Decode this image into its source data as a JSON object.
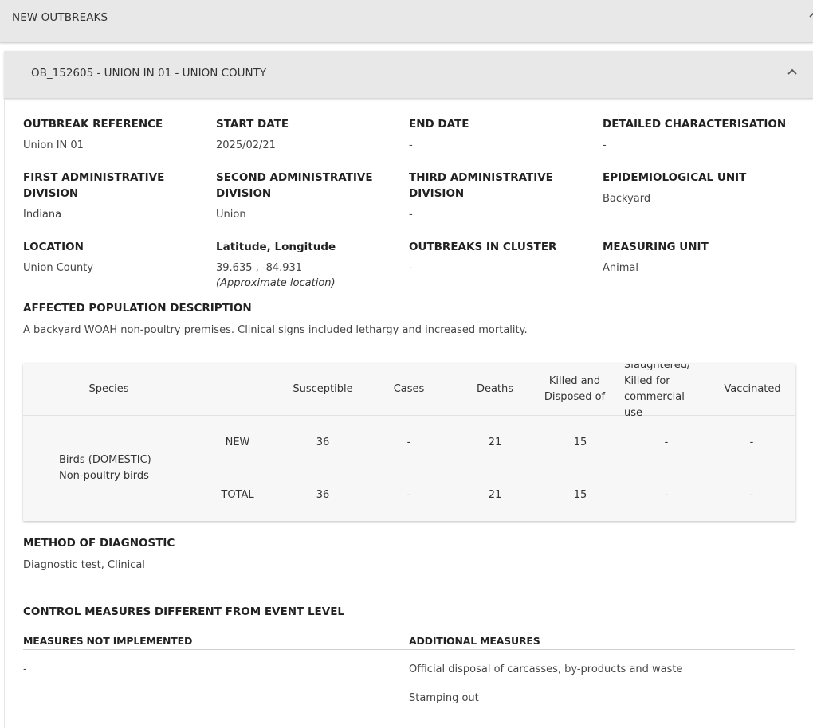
{
  "outer_header": {
    "title": "NEW OUTBREAKS"
  },
  "outbreak_header": {
    "title": "OB_152605 - UNION IN 01 - UNION COUNTY"
  },
  "fields": [
    {
      "label": "OUTBREAK REFERENCE",
      "value": "Union IN 01"
    },
    {
      "label": "START DATE",
      "value": "2025/02/21"
    },
    {
      "label": "END DATE",
      "value": "-"
    },
    {
      "label": "DETAILED CHARACTERISATION",
      "value": "-"
    },
    {
      "label": "FIRST ADMINISTRATIVE DIVISION",
      "value": "Indiana"
    },
    {
      "label": "SECOND ADMINISTRATIVE DIVISION",
      "value": "Union"
    },
    {
      "label": "THIRD ADMINISTRATIVE DIVISION",
      "value": "-"
    },
    {
      "label": "EPIDEMIOLOGICAL UNIT",
      "value": "Backyard"
    },
    {
      "label": "LOCATION",
      "value": "Union County"
    },
    {
      "label": "Latitude, Longitude",
      "value": "39.635 , -84.931",
      "note": "(Approximate location)"
    },
    {
      "label": "OUTBREAKS IN CLUSTER",
      "value": "-"
    },
    {
      "label": "MEASURING UNIT",
      "value": "Animal"
    }
  ],
  "affected_population": {
    "title": "AFFECTED POPULATION DESCRIPTION",
    "text": "A backyard WOAH non-poultry premises. Clinical signs included lethargy and increased mortality."
  },
  "species_table": {
    "headers": {
      "species": "Species",
      "susceptible": "Susceptible",
      "cases": "Cases",
      "deaths": "Deaths",
      "killed": "Killed and Disposed of",
      "slaughtered": "Slaughtered/ Killed for commercial use",
      "vaccinated": "Vaccinated"
    },
    "species_name": "Birds (DOMESTIC)",
    "species_sub": "Non-poultry birds",
    "rows": [
      {
        "label": "NEW",
        "susceptible": "36",
        "cases": "-",
        "deaths": "21",
        "killed": "15",
        "slaughtered": "-",
        "vaccinated": "-"
      },
      {
        "label": "TOTAL",
        "susceptible": "36",
        "cases": "-",
        "deaths": "21",
        "killed": "15",
        "slaughtered": "-",
        "vaccinated": "-"
      }
    ]
  },
  "diagnostic": {
    "title": "METHOD OF DIAGNOSTIC",
    "text": "Diagnostic test, Clinical"
  },
  "control_measures": {
    "title": "CONTROL MEASURES DIFFERENT FROM EVENT LEVEL",
    "not_implemented_head": "MEASURES NOT IMPLEMENTED",
    "additional_head": "ADDITIONAL MEASURES",
    "not_implemented": [
      "-"
    ],
    "additional": [
      "Official disposal of carcasses, by-products and waste",
      "Stamping out"
    ]
  }
}
